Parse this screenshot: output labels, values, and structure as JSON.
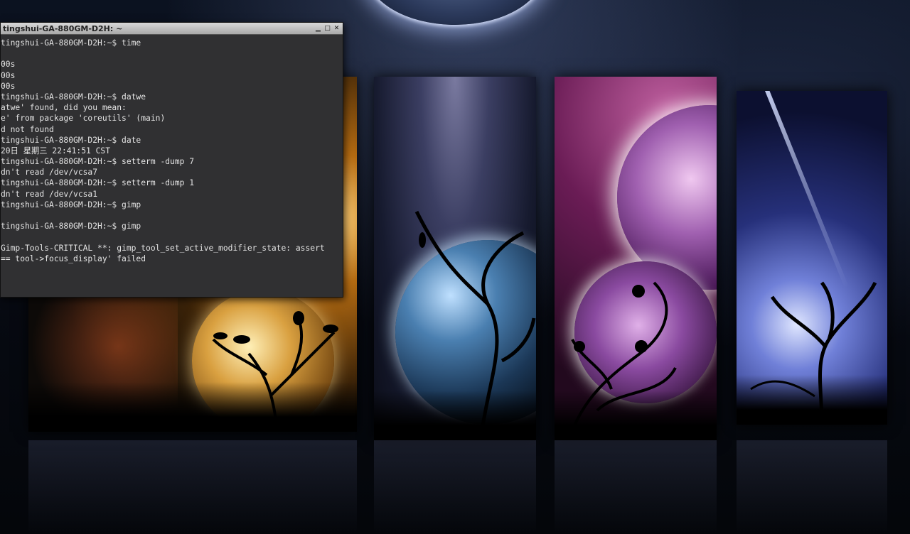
{
  "window": {
    "title": "tingshui-GA-880GM-D2H: ~",
    "controls": {
      "minimize": "▁",
      "maximize": "□",
      "close": "✕"
    }
  },
  "terminal": {
    "lines": [
      "tingshui-GA-880GM-D2H:~$ time",
      "",
      "00s",
      "00s",
      "00s",
      "tingshui-GA-880GM-D2H:~$ datwe",
      "atwe' found, did you mean:",
      "e' from package 'coreutils' (main)",
      "d not found",
      "tingshui-GA-880GM-D2H:~$ date",
      "20日 星期三 22:41:51 CST",
      "tingshui-GA-880GM-D2H:~$ setterm -dump 7",
      "dn't read /dev/vcsa7",
      "tingshui-GA-880GM-D2H:~$ setterm -dump 1",
      "dn't read /dev/vcsa1",
      "tingshui-GA-880GM-D2H:~$ gimp",
      "",
      "tingshui-GA-880GM-D2H:~$ gimp",
      "",
      "Gimp-Tools-CRITICAL **: gimp_tool_set_active_modifier_state: assert",
      "== tool->focus_display' failed"
    ]
  }
}
